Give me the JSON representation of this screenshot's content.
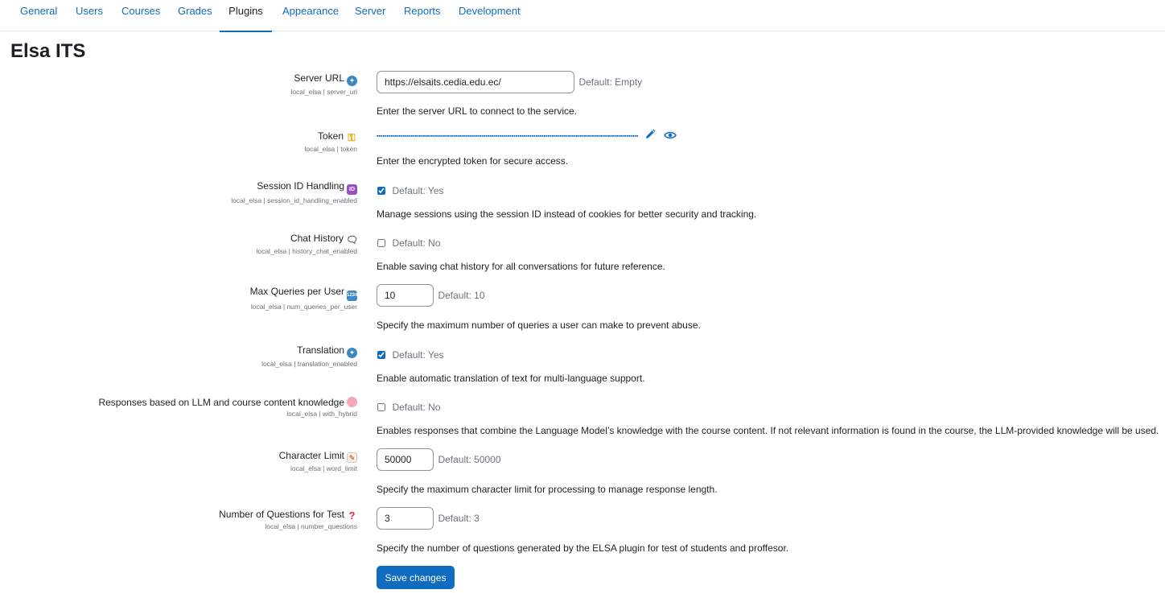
{
  "tabs": [
    {
      "label": "General"
    },
    {
      "label": "Users"
    },
    {
      "label": "Courses"
    },
    {
      "label": "Grades"
    },
    {
      "label": "Plugins",
      "active": true
    },
    {
      "label": "Appearance"
    },
    {
      "label": "Server"
    },
    {
      "label": "Reports"
    },
    {
      "label": "Development"
    }
  ],
  "page": {
    "title": "Elsa ITS"
  },
  "settings": {
    "server_url": {
      "label": "Server URL",
      "icon": "globe-icon",
      "key": "local_elsa | server_url",
      "value": "https://elsaits.cedia.edu.ec/",
      "default": "Default: Empty",
      "description": "Enter the server URL to connect to the service."
    },
    "token": {
      "label": "Token",
      "icon": "key-icon",
      "key": "local_elsa | token",
      "masked": "••••••••••••••••••••••••••••••••••••••••••••••••••••••••••••••••••••••••••••••••••••••••••••••••••••••••••••••••••••••••••••••••••",
      "description": "Enter the encrypted token for secure access."
    },
    "session_id": {
      "label": "Session ID Handling",
      "icon": "id-icon",
      "key": "local_elsa | session_id_handling_enabled",
      "checked": true,
      "default": "Default: Yes",
      "description": "Manage sessions using the session ID instead of cookies for better security and tracking."
    },
    "chat_history": {
      "label": "Chat History",
      "icon": "speech-bubble-icon",
      "key": "local_elsa | history_chat_enabled",
      "checked": false,
      "default": "Default: No",
      "description": "Enable saving chat history for all conversations for future reference."
    },
    "max_queries": {
      "label": "Max Queries per User",
      "icon": "numbers-icon",
      "key": "local_elsa | num_queries_per_user",
      "value": "10",
      "default": "Default: 10",
      "description": "Specify the maximum number of queries a user can make to prevent abuse."
    },
    "translation": {
      "label": "Translation",
      "icon": "globe-icon",
      "key": "local_elsa | translation_enabled",
      "checked": true,
      "default": "Default: Yes",
      "description": "Enable automatic translation of text for multi-language support."
    },
    "hybrid": {
      "label": "Responses based on LLM and course content knowledge",
      "icon": "brain-icon",
      "key": "local_elsa | with_hybrid",
      "checked": false,
      "default": "Default: No",
      "description": "Enables responses that combine the Language Model’s knowledge with the course content. If not relevant information is found in the course, the LLM-provided knowledge will be used."
    },
    "char_limit": {
      "label": "Character Limit",
      "icon": "memo-icon",
      "key": "local_elsa | word_limit",
      "value": "50000",
      "default": "Default: 50000",
      "description": "Specify the maximum character limit for processing to manage response length."
    },
    "num_questions": {
      "label": "Number of Questions for Test",
      "icon": "question-mark-icon",
      "key": "local_elsa | number_questions",
      "value": "3",
      "default": "Default: 3",
      "description": "Specify the number of questions generated by the ELSA plugin for test of students and proffesor."
    }
  },
  "save_button": {
    "label": "Save changes"
  },
  "colors": {
    "accent": "#0f6cbf",
    "text": "#1d2125",
    "muted": "#6a737b"
  }
}
